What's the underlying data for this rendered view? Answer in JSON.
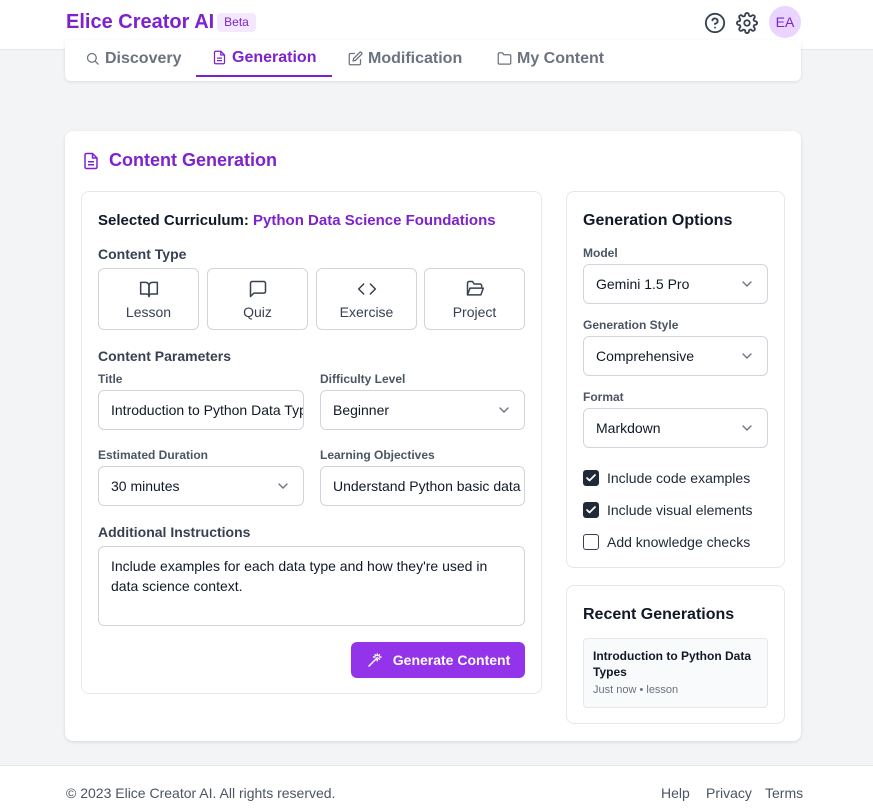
{
  "app": {
    "title": "Elice Creator AI",
    "badge": "Beta",
    "avatar_initials": "EA"
  },
  "colors": {
    "accent": "#7e22ce",
    "primary_button": "#9333ea"
  },
  "tabs": [
    {
      "label": "Discovery",
      "icon": "search-icon"
    },
    {
      "label": "Generation",
      "icon": "document-icon",
      "active": true
    },
    {
      "label": "Modification",
      "icon": "edit-icon"
    },
    {
      "label": "My Content",
      "icon": "folder-icon"
    }
  ],
  "main": {
    "title": "Content Generation",
    "curriculum_label": "Selected Curriculum:",
    "curriculum_name": "Python Data Science Foundations",
    "content_type_label": "Content Type",
    "content_types": [
      {
        "label": "Lesson",
        "icon": "book-open-icon"
      },
      {
        "label": "Quiz",
        "icon": "message-square-icon"
      },
      {
        "label": "Exercise",
        "icon": "code-icon"
      },
      {
        "label": "Project",
        "icon": "folder-open-icon"
      }
    ],
    "params_label": "Content Parameters",
    "title_label": "Title",
    "title_value": "Introduction to Python Data Types",
    "difficulty_label": "Difficulty Level",
    "difficulty_value": "Beginner",
    "duration_label": "Estimated Duration",
    "duration_value": "30 minutes",
    "objectives_label": "Learning Objectives",
    "objectives_value": "Understand Python basic data types",
    "instructions_label": "Additional Instructions",
    "instructions_value": "Include examples for each data type and how they're used in data science context.",
    "generate_label": "Generate Content"
  },
  "options": {
    "title": "Generation Options",
    "model_label": "Model",
    "model_value": "Gemini 1.5 Pro",
    "style_label": "Generation Style",
    "style_value": "Comprehensive",
    "format_label": "Format",
    "format_value": "Markdown",
    "checks": [
      {
        "label": "Include code examples",
        "checked": true
      },
      {
        "label": "Include visual elements",
        "checked": true
      },
      {
        "label": "Add knowledge checks",
        "checked": false
      }
    ]
  },
  "recent": {
    "title": "Recent Generations",
    "items": [
      {
        "title": "Introduction to Python Data Types",
        "meta": "Just now • lesson"
      }
    ]
  },
  "footer": {
    "copyright": "© 2023 Elice Creator AI. All rights reserved.",
    "links": [
      "Help",
      "Privacy",
      "Terms"
    ]
  }
}
